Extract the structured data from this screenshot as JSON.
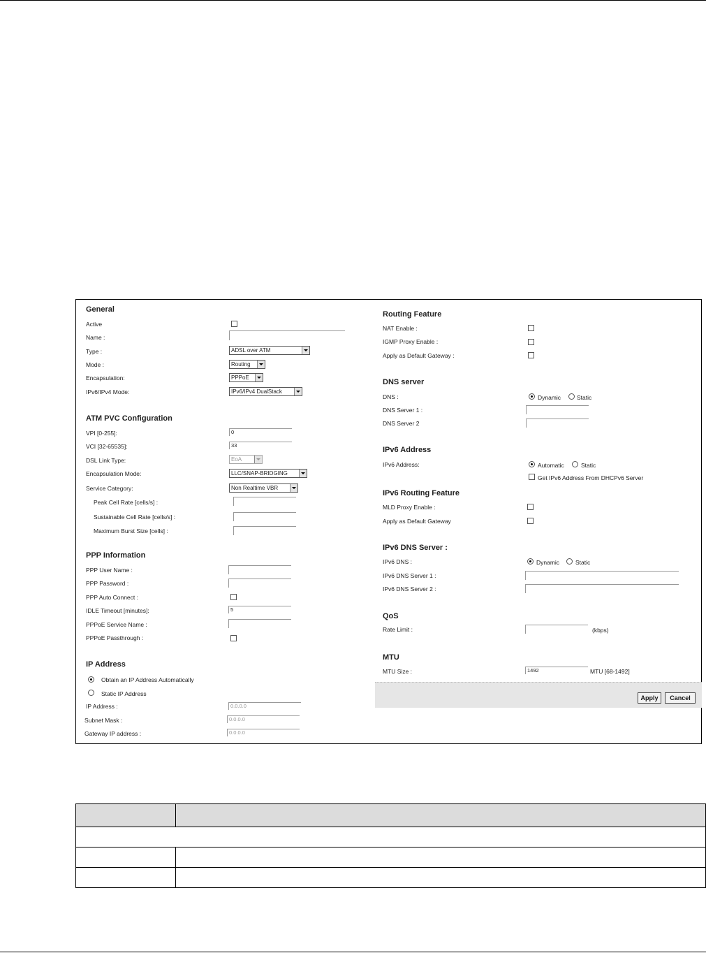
{
  "general": {
    "title": "General",
    "active_label": "Active",
    "name_label": "Name :",
    "name_value": "",
    "type_label": "Type :",
    "type_value": "ADSL over ATM",
    "mode_label": "Mode :",
    "mode_value": "Routing",
    "encapsulation_label": "Encapsulation:",
    "encapsulation_value": "PPPoE",
    "ipmode_label": "IPv6/IPv4 Mode:",
    "ipmode_value": "IPv6/IPv4 DualStack"
  },
  "atm": {
    "title": "ATM PVC Configuration",
    "vpi_label": "VPI [0-255]:",
    "vpi_value": "0",
    "vci_label": "VCI [32-65535]:",
    "vci_value": "33",
    "dsl_label": "DSL Link Type:",
    "dsl_value": "EoA",
    "encmode_label": "Encapsulation Mode:",
    "encmode_value": "LLC/SNAP-BRIDGING",
    "service_label": "Service Category:",
    "service_value": "Non Realtime VBR",
    "pcr_label": "Peak Cell Rate [cells/s] :",
    "scr_label": "Sustainable Cell Rate [cells/s] :",
    "mbs_label": "Maximum Burst Size [cells] :"
  },
  "ppp": {
    "title": "PPP Information",
    "user_label": "PPP User Name :",
    "pass_label": "PPP Password :",
    "auto_label": "PPP Auto Connect :",
    "idle_label": "IDLE Timeout [minutes]:",
    "idle_value": "5",
    "service_label": "PPPoE Service Name :",
    "passthrough_label": "PPPoE Passthrough :"
  },
  "ip": {
    "title": "IP Address",
    "auto_label": "Obtain an IP Address Automatically",
    "static_label": "Static IP Address",
    "addr_label": "IP Address :",
    "addr_value": "0.0.0.0",
    "mask_label": "Subnet Mask :",
    "mask_value": "0.0.0.0",
    "gw_label": "Gateway IP address :",
    "gw_value": "0.0.0.0"
  },
  "routing": {
    "title": "Routing Feature",
    "nat_label": "NAT Enable :",
    "igmp_label": "IGMP Proxy Enable :",
    "default_label": "Apply as Default Gateway :"
  },
  "dns": {
    "title": "DNS server",
    "dns_label": "DNS :",
    "dynamic": "Dynamic",
    "static": "Static",
    "s1_label": "DNS Server 1 :",
    "s2_label": "DNS Server 2"
  },
  "ipv6addr": {
    "title": "IPv6 Address",
    "addr_label": "IPv6 Address:",
    "automatic": "Automatic",
    "static": "Static",
    "dhcp_label": "Get IPv6 Address From DHCPv6 Server"
  },
  "ipv6routing": {
    "title": "IPv6 Routing Feature",
    "mld_label": "MLD Proxy Enable :",
    "default_label": "Apply as Default Gateway"
  },
  "ipv6dns": {
    "title": "IPv6 DNS Server :",
    "dns_label": "IPv6 DNS :",
    "dynamic": "Dynamic",
    "static": "Static",
    "s1_label": "IPv6 DNS Server 1 :",
    "s2_label": "IPv6 DNS Server 2 :"
  },
  "qos": {
    "title": "QoS",
    "rate_label": "Rate Limit :",
    "unit": "(kbps)"
  },
  "mtu": {
    "title": "MTU",
    "size_label": "MTU Size :",
    "size_value": "1492",
    "range": "MTU [68-1492]"
  },
  "buttons": {
    "apply": "Apply",
    "cancel": "Cancel"
  }
}
